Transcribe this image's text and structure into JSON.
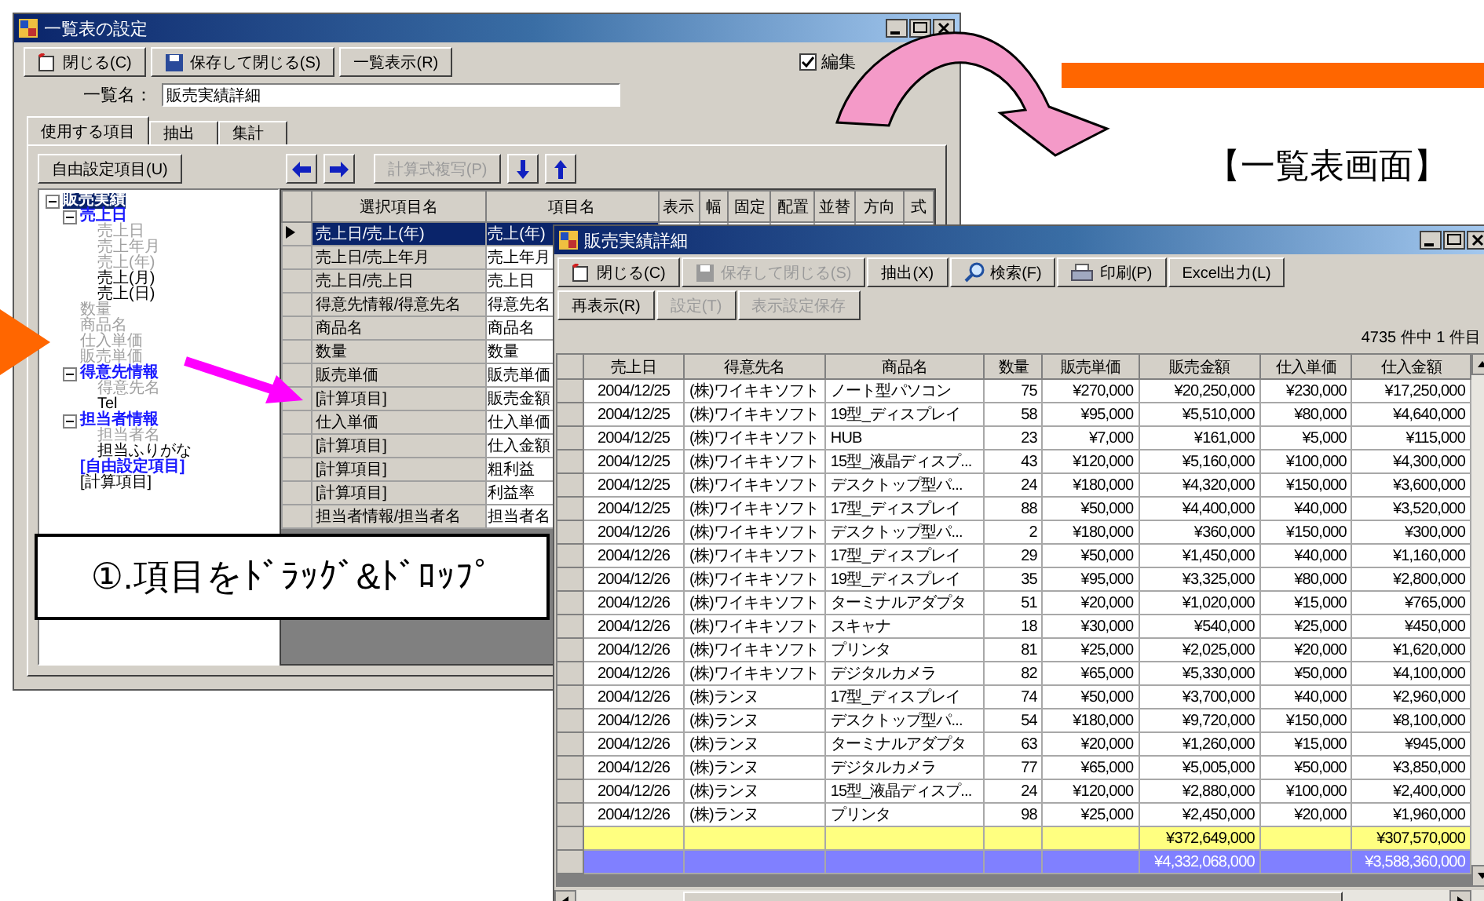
{
  "heading": "【一覧表画面】",
  "callout": "①.項目をﾄﾞﾗｯｸﾞ&ﾄﾞﾛｯﾌﾟ",
  "settings_window": {
    "title": "一覧表の設定",
    "toolbar": [
      {
        "label": "閉じる(C)",
        "kind": "close",
        "disabled": false
      },
      {
        "label": "保存して閉じる(S)",
        "kind": "save",
        "disabled": false
      },
      {
        "label": "一覧表示(R)",
        "kind": "plain",
        "disabled": false
      }
    ],
    "edit_checkbox": {
      "label": "編集",
      "checked": true
    },
    "name_field": {
      "label": "一覧名：",
      "value": "販売実績詳細"
    },
    "tabs": [
      {
        "label": "使用する項目",
        "selected": true
      },
      {
        "label": "抽出",
        "selected": false
      },
      {
        "label": "集計",
        "selected": false
      }
    ],
    "free_item_button": {
      "label": "自由設定項目(U)",
      "disabled": false
    },
    "copy_formula_button": {
      "label": "計算式複写(P)",
      "disabled": true
    },
    "tree": [
      {
        "label": "販売実績",
        "kind": "group",
        "selected": true,
        "expanded": true,
        "children": [
          {
            "label": "売上日",
            "kind": "group",
            "selected": false,
            "expanded": true,
            "children": [
              {
                "label": "売上日",
                "kind": "field",
                "used": true,
                "selected": false
              },
              {
                "label": "売上年月",
                "kind": "field",
                "used": true,
                "selected": false
              },
              {
                "label": "売上(年)",
                "kind": "field",
                "used": true,
                "selected": false
              },
              {
                "label": "売上(月)",
                "kind": "field",
                "used": false,
                "selected": false
              },
              {
                "label": "売上(日)",
                "kind": "field",
                "used": false,
                "selected": false
              }
            ]
          },
          {
            "label": "数量",
            "kind": "field",
            "used": true,
            "selected": false
          },
          {
            "label": "商品名",
            "kind": "field",
            "used": true,
            "selected": false
          },
          {
            "label": "仕入単価",
            "kind": "field",
            "used": true,
            "selected": false
          },
          {
            "label": "販売単価",
            "kind": "field",
            "used": true,
            "selected": false
          },
          {
            "label": "得意先情報",
            "kind": "group",
            "selected": false,
            "expanded": true,
            "children": [
              {
                "label": "得意先名",
                "kind": "field",
                "used": true,
                "selected": false
              },
              {
                "label": "Tel",
                "kind": "field",
                "used": false,
                "selected": false
              }
            ]
          },
          {
            "label": "担当者情報",
            "kind": "group",
            "selected": false,
            "expanded": true,
            "children": [
              {
                "label": "担当者名",
                "kind": "field",
                "used": true,
                "selected": false
              },
              {
                "label": "担当ふりがな",
                "kind": "field",
                "used": false,
                "selected": false
              }
            ]
          },
          {
            "label": "[自由設定項目]",
            "kind": "group",
            "selected": false
          },
          {
            "label": "[計算項目]",
            "kind": "field",
            "used": false,
            "selected": false
          }
        ]
      }
    ],
    "grid": {
      "columns": [
        "選択項目名",
        "項目名",
        "表示",
        "幅",
        "固定",
        "配置",
        "並替",
        "方向",
        "式"
      ],
      "rows": [
        {
          "source": "売上日/売上(年)",
          "name": "売上(年)",
          "selected": true
        },
        {
          "source": "売上日/売上年月",
          "name": "売上年月",
          "selected": false
        },
        {
          "source": "売上日/売上日",
          "name": "売上日",
          "selected": false
        },
        {
          "source": "得意先情報/得意先名",
          "name": "得意先名",
          "selected": false
        },
        {
          "source": "商品名",
          "name": "商品名",
          "selected": false
        },
        {
          "source": "数量",
          "name": "数量",
          "selected": false
        },
        {
          "source": "販売単価",
          "name": "販売単価",
          "selected": false
        },
        {
          "source": "[計算項目]",
          "name": "販売金額",
          "selected": false
        },
        {
          "source": "仕入単価",
          "name": "仕入単価",
          "selected": false
        },
        {
          "source": "[計算項目]",
          "name": "仕入金額",
          "selected": false
        },
        {
          "source": "[計算項目]",
          "name": "粗利益",
          "selected": false
        },
        {
          "source": "[計算項目]",
          "name": "利益率",
          "selected": false
        },
        {
          "source": "担当者情報/担当者名",
          "name": "担当者名",
          "selected": false
        }
      ]
    }
  },
  "list_window": {
    "title": "販売実績詳細",
    "toolbar_rows": [
      [
        {
          "label": "閉じる(C)",
          "kind": "close",
          "disabled": false
        },
        {
          "label": "保存して閉じる(S)",
          "kind": "save",
          "disabled": true
        },
        {
          "label": "抽出(X)",
          "kind": "plain",
          "disabled": false
        },
        {
          "label": "検索(F)",
          "kind": "search",
          "disabled": false
        },
        {
          "label": "印刷(P)",
          "kind": "print",
          "disabled": false
        },
        {
          "label": "Excel出力(L)",
          "kind": "plain",
          "disabled": false
        }
      ],
      [
        {
          "label": "再表示(R)",
          "kind": "plain",
          "disabled": false
        },
        {
          "label": "設定(T)",
          "kind": "plain",
          "disabled": true
        },
        {
          "label": "表示設定保存",
          "kind": "plain",
          "disabled": true
        }
      ]
    ],
    "count": "4735 件中 1 件目",
    "table": {
      "columns": [
        "売上日",
        "得意先名",
        "商品名",
        "数量",
        "販売単価",
        "販売金額",
        "仕入単価",
        "仕入金額"
      ],
      "rows": [
        [
          "2004/12/25",
          "(株)ワイキキソフト",
          "ノート型パソコン",
          "75",
          "¥270,000",
          "¥20,250,000",
          "¥230,000",
          "¥17,250,000"
        ],
        [
          "2004/12/25",
          "(株)ワイキキソフト",
          "19型_ディスプレイ",
          "58",
          "¥95,000",
          "¥5,510,000",
          "¥80,000",
          "¥4,640,000"
        ],
        [
          "2004/12/25",
          "(株)ワイキキソフト",
          "HUB",
          "23",
          "¥7,000",
          "¥161,000",
          "¥5,000",
          "¥115,000"
        ],
        [
          "2004/12/25",
          "(株)ワイキキソフト",
          "15型_液晶ディスプ...",
          "43",
          "¥120,000",
          "¥5,160,000",
          "¥100,000",
          "¥4,300,000"
        ],
        [
          "2004/12/25",
          "(株)ワイキキソフト",
          "デスクトップ型パ...",
          "24",
          "¥180,000",
          "¥4,320,000",
          "¥150,000",
          "¥3,600,000"
        ],
        [
          "2004/12/25",
          "(株)ワイキキソフト",
          "17型_ディスプレイ",
          "88",
          "¥50,000",
          "¥4,400,000",
          "¥40,000",
          "¥3,520,000"
        ],
        [
          "2004/12/26",
          "(株)ワイキキソフト",
          "デスクトップ型パ...",
          "2",
          "¥180,000",
          "¥360,000",
          "¥150,000",
          "¥300,000"
        ],
        [
          "2004/12/26",
          "(株)ワイキキソフト",
          "17型_ディスプレイ",
          "29",
          "¥50,000",
          "¥1,450,000",
          "¥40,000",
          "¥1,160,000"
        ],
        [
          "2004/12/26",
          "(株)ワイキキソフト",
          "19型_ディスプレイ",
          "35",
          "¥95,000",
          "¥3,325,000",
          "¥80,000",
          "¥2,800,000"
        ],
        [
          "2004/12/26",
          "(株)ワイキキソフト",
          "ターミナルアダプタ",
          "51",
          "¥20,000",
          "¥1,020,000",
          "¥15,000",
          "¥765,000"
        ],
        [
          "2004/12/26",
          "(株)ワイキキソフト",
          "スキャナ",
          "18",
          "¥30,000",
          "¥540,000",
          "¥25,000",
          "¥450,000"
        ],
        [
          "2004/12/26",
          "(株)ワイキキソフト",
          "プリンタ",
          "81",
          "¥25,000",
          "¥2,025,000",
          "¥20,000",
          "¥1,620,000"
        ],
        [
          "2004/12/26",
          "(株)ワイキキソフト",
          "デジタルカメラ",
          "82",
          "¥65,000",
          "¥5,330,000",
          "¥50,000",
          "¥4,100,000"
        ],
        [
          "2004/12/26",
          "(株)ランヌ",
          "17型_ディスプレイ",
          "74",
          "¥50,000",
          "¥3,700,000",
          "¥40,000",
          "¥2,960,000"
        ],
        [
          "2004/12/26",
          "(株)ランヌ",
          "デスクトップ型パ...",
          "54",
          "¥180,000",
          "¥9,720,000",
          "¥150,000",
          "¥8,100,000"
        ],
        [
          "2004/12/26",
          "(株)ランヌ",
          "ターミナルアダプタ",
          "63",
          "¥20,000",
          "¥1,260,000",
          "¥15,000",
          "¥945,000"
        ],
        [
          "2004/12/26",
          "(株)ランヌ",
          "デジタルカメラ",
          "77",
          "¥65,000",
          "¥5,005,000",
          "¥50,000",
          "¥3,850,000"
        ],
        [
          "2004/12/26",
          "(株)ランヌ",
          "15型_液晶ディスプ...",
          "24",
          "¥120,000",
          "¥2,880,000",
          "¥100,000",
          "¥2,400,000"
        ],
        [
          "2004/12/26",
          "(株)ランヌ",
          "プリンタ",
          "98",
          "¥25,000",
          "¥2,450,000",
          "¥20,000",
          "¥1,960,000"
        ]
      ],
      "summary_rows": [
        {
          "kind": "subtotal",
          "sales_amount": "¥372,649,000",
          "purchase_amount": "¥307,570,000"
        },
        {
          "kind": "total",
          "sales_amount": "¥4,332,068,000",
          "purchase_amount": "¥3,588,360,000"
        }
      ]
    }
  }
}
